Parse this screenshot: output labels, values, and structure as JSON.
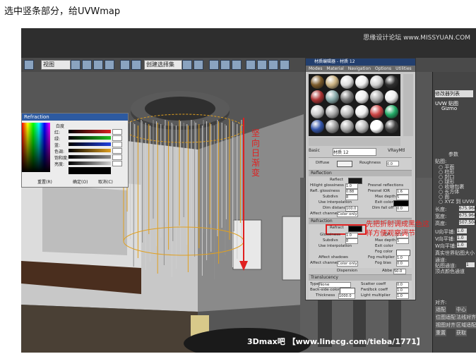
{
  "caption": "选中竖条部分，给UVWmap",
  "watermark_top": "思缘设计论坛 www.MISSYUAN.COM",
  "watermark_bottom": "3Dmax吧 【www.linecg.com/tieba/1771】",
  "watermark_logo": "思缘网",
  "toolbar": {
    "view_dropdown": "视图",
    "selection_set": "创建选择集"
  },
  "color_picker": {
    "title": "Refraction",
    "whiteness_label": "白度",
    "channels": [
      {
        "label": "红:",
        "color": "#d92020"
      },
      {
        "label": "绿:",
        "color": "#20c020"
      },
      {
        "label": "蓝:",
        "color": "#2040e0"
      },
      {
        "label": "色调:",
        "color": "#e0a020"
      },
      {
        "label": "饱和度:",
        "color": "#888888"
      },
      {
        "label": "亮度:",
        "color": "#cccccc"
      }
    ],
    "reset_button": "重置(R)",
    "ok_button": "确定(O)",
    "cancel_button": "取消(C)"
  },
  "material_editor": {
    "title": "材质编辑器 - 材质 12",
    "menus": [
      "Modes",
      "Material",
      "Navigation",
      "Options",
      "Utilities"
    ],
    "material_name": "材质 12",
    "material_type": "VRayMtl",
    "basic_label": "Basic",
    "diffuse_label": "Diffuse",
    "roughness_label": "Roughness",
    "roughness_value": "0.0",
    "reflection_header": "Reflection",
    "reflect_label": "Reflect",
    "hilight_label": "Hilight glossiness",
    "hilight_value": "1.0",
    "refl_gloss_label": "Refl. glossiness",
    "refl_gloss_value": "0.88",
    "subdivs_label": "Subdivs",
    "subdivs_value": "8",
    "use_interp_label": "Use interpolation",
    "dim_dist_label": "Dim distance",
    "dim_dist_value": "100.0",
    "affect_channels_label": "Affect channels",
    "affect_channels_value": "Color only",
    "fresnel_label": "Fresnel reflections",
    "fresnel_ior_label": "Fresnel IOR",
    "fresnel_ior_value": "1.6",
    "max_depth_label": "Max depth",
    "max_depth_value": "5",
    "exit_color_label": "Exit color",
    "dim_falloff_label": "Dim fall off",
    "dim_falloff_value": "0.0",
    "refraction_header": "Refraction",
    "refract_label": "Refract",
    "glossiness_label": "Glossiness",
    "glossiness_value": "1.0",
    "ior_label": "IOR",
    "ior_value": "1.6",
    "refr_subdivs_value": "8",
    "max_depth2_value": "5",
    "exit_color2_label": "Exit color",
    "fog_color_label": "Fog color",
    "fog_mult_label": "Fog multiplier",
    "fog_mult_value": "1.0",
    "fog_bias_label": "Fog bias",
    "fog_bias_value": "0.0",
    "affect_shadows_label": "Affect shadows",
    "abbe_label": "Abbe",
    "abbe_value": "50.0",
    "dispersion_label": "Dispersion",
    "translucency_header": "Translucency",
    "type_label": "Type",
    "type_value": "None",
    "back_side_label": "Back-side color",
    "thickness_label": "Thickness",
    "thickness_value": "1000.0",
    "scatter_label": "Scatter coeff",
    "scatter_value": "0.0",
    "fwd_bck_label": "Fwd/bck coeff",
    "fwd_bck_value": "1.0",
    "light_mult_label": "Light multiplier",
    "light_mult_value": "1.0"
  },
  "annotations": {
    "vertical_note": "坚向日渐变",
    "refract_note": "先把折射调成黑色这样方便观察调节"
  },
  "command_panel": {
    "modifier_list": "修改器列表",
    "stack_item_1": "UVW 贴图",
    "stack_item_2": "Gizmo",
    "params_header": "参数",
    "mapping_label": "贴图:",
    "options": [
      "平面",
      "柱形",
      "封口",
      "球形",
      "收缩包裹",
      "长方体",
      "面",
      "XYZ 到 UVW"
    ],
    "length_label": "长度:",
    "length_value": "675.964",
    "width_label": "宽度:",
    "width_value": "675.964",
    "height_label": "高度:",
    "height_value": "507.504",
    "u_tile_label": "U向平铺:",
    "u_tile_value": "1.0",
    "v_tile_label": "V向平铺:",
    "v_tile_value": "1.0",
    "w_tile_label": "W向平铺:",
    "w_tile_value": "1.0",
    "real_world_label": "真实世界贴图大小",
    "channel_label": "通道:",
    "map_channel_label": "贴图通道:",
    "map_channel_value": "1",
    "vertex_color_label": "顶点颜色通道",
    "align_label": "对齐:",
    "align_btns": [
      "适配",
      "中心",
      "位图适配",
      "法线对齐",
      "视图对齐",
      "区域适配",
      "重置",
      "获取"
    ]
  }
}
